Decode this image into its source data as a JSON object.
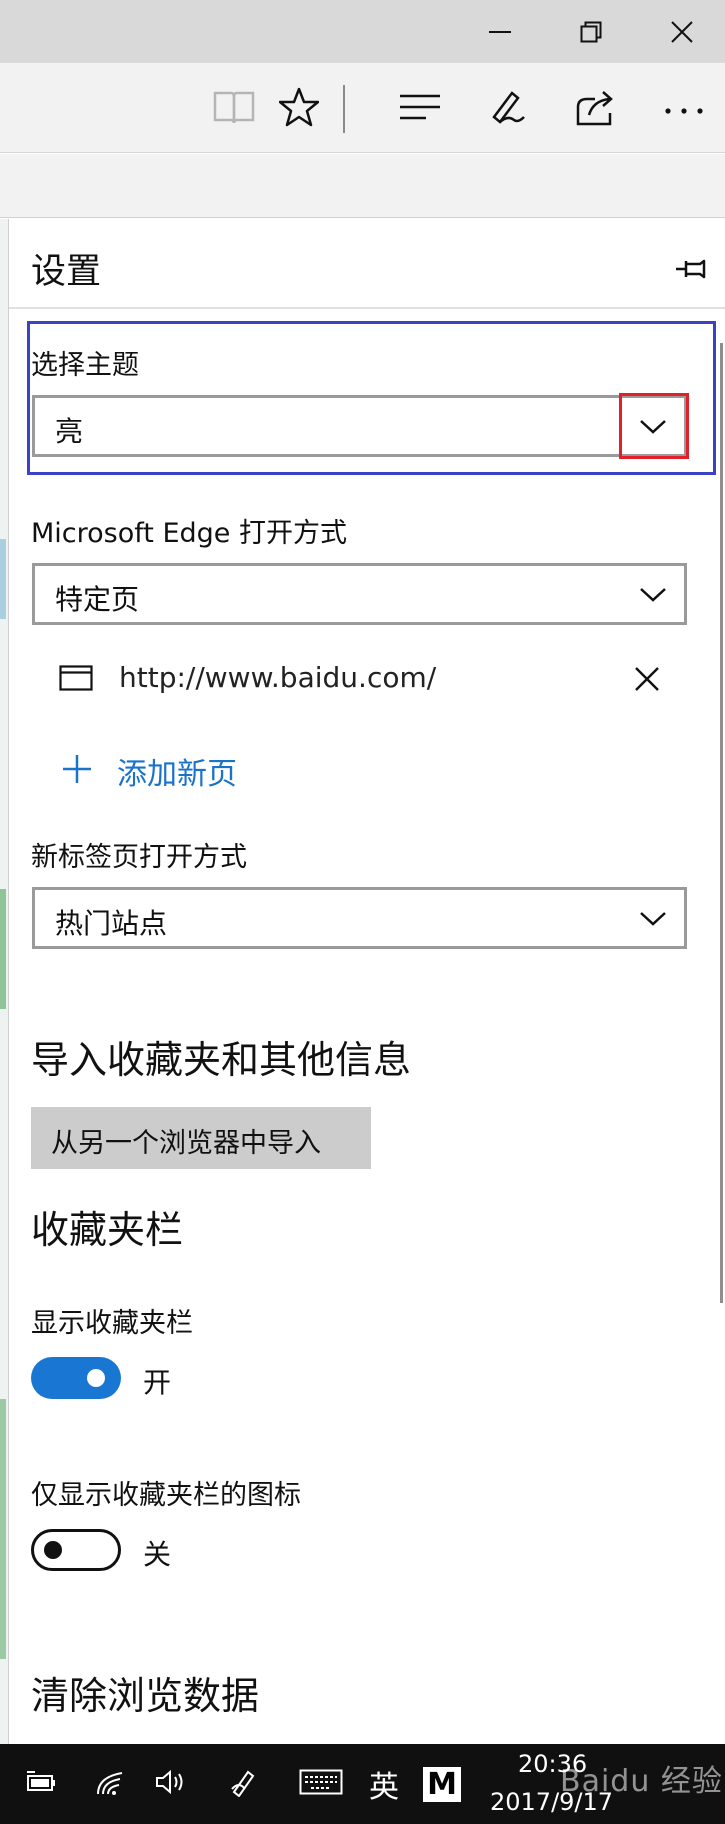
{
  "window": {
    "minimize_icon": "minimize-icon",
    "restore_icon": "restore-icon",
    "close_icon": "close-icon"
  },
  "toolbar": {
    "icons": [
      "reading-view-icon",
      "favorite-star-icon",
      "hub-icon",
      "web-note-icon",
      "share-icon",
      "more-icon"
    ]
  },
  "settings": {
    "title": "设置",
    "pin_icon": "pin-icon",
    "theme": {
      "label": "选择主题",
      "value": "亮"
    },
    "open_with": {
      "label": "Microsoft Edge 打开方式",
      "value": "特定页",
      "url": "http://www.baidu.com/",
      "add_page": "添加新页"
    },
    "new_tab": {
      "label": "新标签页打开方式",
      "value": "热门站点"
    },
    "import": {
      "heading": "导入收藏夹和其他信息",
      "button": "从另一个浏览器中导入"
    },
    "favorites_bar": {
      "heading": "收藏夹栏",
      "show_label": "显示收藏夹栏",
      "show_state": "开",
      "icons_only_label": "仅显示收藏夹栏的图标",
      "icons_only_state": "关"
    },
    "clear_heading": "清除浏览数据"
  },
  "highlight_colors": {
    "blue": "#3a43c6",
    "red": "#e2202a"
  },
  "taskbar": {
    "ime_lang": "英",
    "ime_mode": "M",
    "time": "20:36",
    "date": "2017/9/17",
    "watermark": "Baidu 经验"
  }
}
